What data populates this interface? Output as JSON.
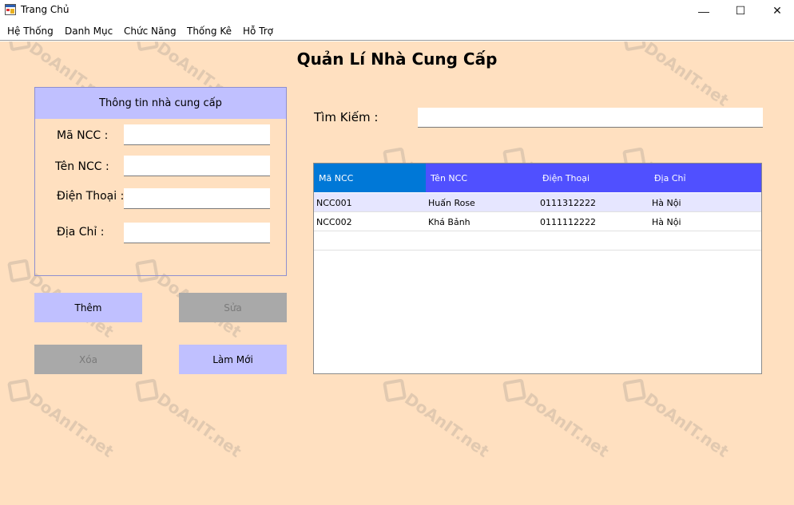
{
  "window": {
    "title": "Trang Chủ",
    "minimize_glyph": "—",
    "maximize_glyph": "☐",
    "close_glyph": "✕"
  },
  "menu": [
    "Hệ Thống",
    "Danh Mục",
    "Chức Năng",
    "Thống Kê",
    "Hỗ Trợ"
  ],
  "page_title": "Quản Lí Nhà Cung Cấp",
  "info_panel": {
    "header": "Thông tin nhà cung cấp",
    "fields": [
      {
        "label": "Mã NCC :",
        "value": ""
      },
      {
        "label": "Tên NCC :",
        "value": ""
      },
      {
        "label": "Điện Thoại :",
        "value": ""
      },
      {
        "label": "Địa Chỉ :",
        "value": ""
      }
    ]
  },
  "buttons": {
    "add": "Thêm",
    "edit": "Sửa",
    "delete": "Xóa",
    "refresh": "Làm Mới"
  },
  "search": {
    "label": "Tìm Kiếm :",
    "value": ""
  },
  "table": {
    "columns": [
      "Mã NCC",
      "Tên NCC",
      "Điện Thoại",
      "Địa Chỉ"
    ],
    "rows": [
      [
        "NCC001",
        "Huấn Rose",
        "0111312222",
        "Hà Nội"
      ],
      [
        "NCC002",
        "Khá Bảnh",
        "0111112222",
        "Hà Nội"
      ]
    ]
  },
  "watermark": "DoAnIT.net",
  "colors": {
    "background": "#ffe0c0",
    "panel_header": "#c0c0ff",
    "grid_header": "#5050ff",
    "grid_header_selected": "#0078d7",
    "button_disabled": "#a9a9a9"
  }
}
